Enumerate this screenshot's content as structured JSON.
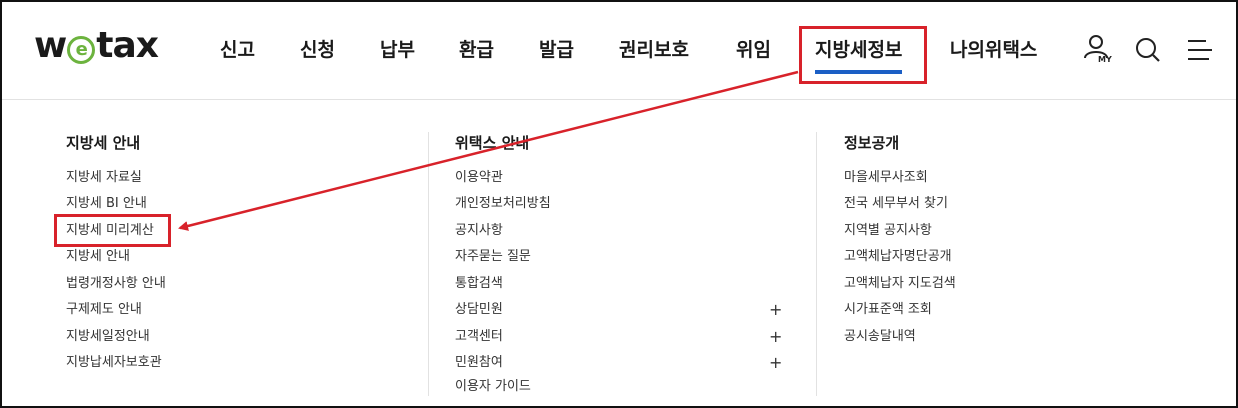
{
  "header": {
    "logo": "wetax",
    "nav": [
      {
        "label": "신고"
      },
      {
        "label": "신청"
      },
      {
        "label": "납부"
      },
      {
        "label": "환급"
      },
      {
        "label": "발급"
      },
      {
        "label": "권리보호"
      },
      {
        "label": "위임"
      },
      {
        "label": "지방세정보"
      },
      {
        "label": "나의위택스"
      }
    ],
    "active_nav": "지방세정보",
    "my_label": "MY",
    "icons": [
      "user-my-icon",
      "search-icon",
      "hamburger-menu-icon"
    ]
  },
  "menu": {
    "columns": [
      {
        "title": "지방세 안내",
        "items": [
          "지방세 자료실",
          "지방세 BI 안내",
          "지방세 미리계산",
          "지방세 안내",
          "법령개정사항 안내",
          "구제제도 안내",
          "지방세일정안내",
          "지방납세자보호관"
        ]
      },
      {
        "title": "위택스 안내",
        "items": [
          "이용약관",
          "개인정보처리방침",
          "공지사항",
          "자주묻는 질문",
          "통합검색",
          "상담민원",
          "고객센터",
          "민원참여",
          "이용자 가이드"
        ],
        "expandable": [
          "상담민원",
          "고객센터",
          "민원참여"
        ],
        "expand_symbol": "+"
      },
      {
        "title": "정보공개",
        "items": [
          "마을세무사조회",
          "전국 세무부서 찾기",
          "지역별 공지사항",
          "고액체납자명단공개",
          "고액체납자 지도검색",
          "시가표준액 조회",
          "공시송달내역"
        ]
      }
    ]
  },
  "annotation": {
    "color": "#d8222a",
    "highlighted_nav": "지방세정보",
    "highlighted_item": "지방세 미리계산"
  },
  "colors": {
    "accent": "#1b5fc5",
    "logo_green": "#6cb33e",
    "annotation_red": "#d8222a"
  }
}
